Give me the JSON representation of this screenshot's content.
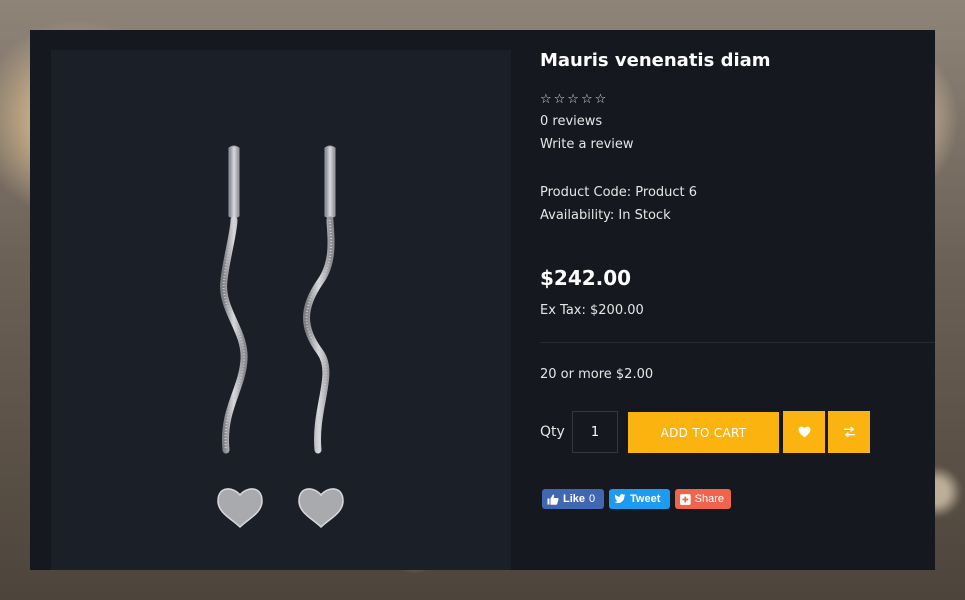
{
  "product": {
    "title": "Mauris venenatis diam",
    "rating_stars": "☆☆☆☆☆",
    "reviews": "0 reviews",
    "write_review": "Write a review",
    "code": "Product Code: Product 6",
    "availability": "Availability: In Stock",
    "price": "$242.00",
    "ex_tax": "Ex Tax: $200.00",
    "discount": "20 or more $2.00"
  },
  "purchase": {
    "qty_label": "Qty",
    "qty_value": "1",
    "add_to_cart": "ADD TO CART",
    "wishlist_icon": "heart-icon",
    "compare_icon": "compare-arrows-icon"
  },
  "social": {
    "like": "Like",
    "like_count": "0",
    "tweet": "Tweet",
    "share": "Share"
  },
  "colors": {
    "accent": "#fbb40f",
    "panel": "#15181e",
    "facebook": "#4267b2",
    "twitter": "#1d9bf0",
    "share": "#f0644e"
  }
}
